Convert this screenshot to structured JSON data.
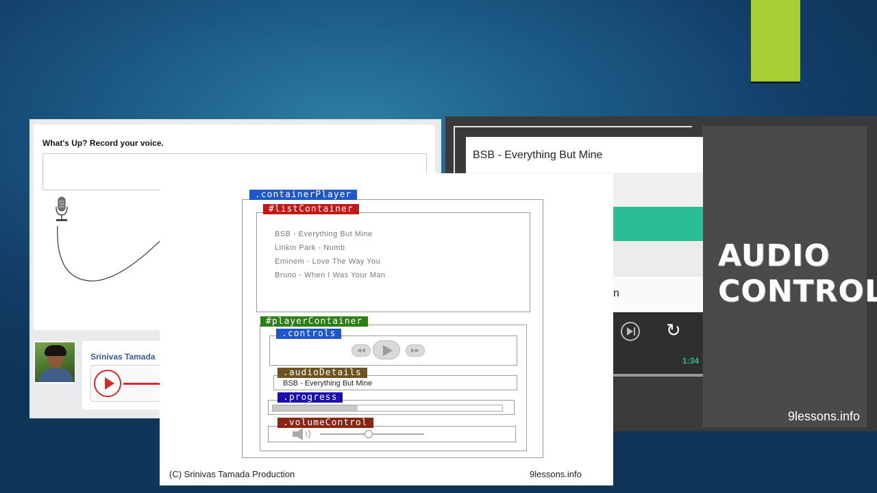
{
  "slide": {
    "accent_color": "#a7cf34"
  },
  "voice_panel": {
    "title": "What's Up? Record your voice.",
    "user_name": "Srinivas Tamada"
  },
  "controls_panel": {
    "now_playing": "BSB - Everything But Mine",
    "partial_row_text": "n",
    "time": "1:34",
    "headline_line1": "AUDIO",
    "headline_line2": "CONTROLS",
    "brand": "9lessons.info",
    "accent_color": "#2bbd96"
  },
  "diagram": {
    "labels": {
      "container_player": ".containerPlayer",
      "list_container": "#listContainer",
      "player_container": "#playerContainer",
      "controls": ".controls",
      "audio_details": ".audioDetails",
      "progress": ".progress",
      "volume_control": ".volumeControl"
    },
    "tracks": [
      "BSB - Everything But Mine",
      "Linkin Park - Numb",
      "Eminem - Love The Way You",
      "Bruno - When I Was Your Man"
    ],
    "current_track": "BSB - Everything But Mine",
    "progress_fraction": 0.37,
    "volume_fraction": 0.47,
    "footer_left": "(C) Srinivas Tamada Production",
    "footer_right": "9lessons.info"
  }
}
